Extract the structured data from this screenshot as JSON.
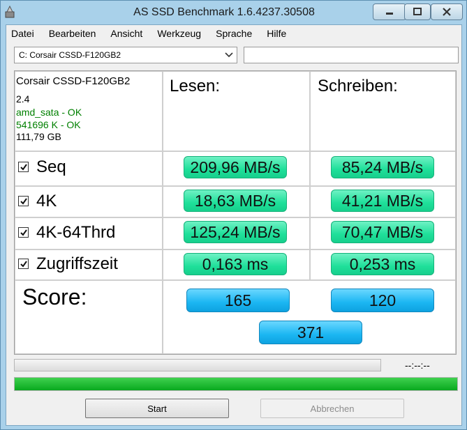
{
  "window": {
    "title": "AS SSD Benchmark 1.6.4237.30508"
  },
  "menu": {
    "items": [
      "Datei",
      "Bearbeiten",
      "Ansicht",
      "Werkzeug",
      "Sprache",
      "Hilfe"
    ]
  },
  "drive": {
    "selected": "C: Corsair CSSD-F120GB2",
    "text_value": ""
  },
  "info": {
    "model": "Corsair CSSD-F120GB2",
    "firmware": "2.4",
    "driver": "amd_sata - OK",
    "alignment": "541696 K - OK",
    "capacity": "111,79 GB",
    "ok_color": "#008000"
  },
  "columns": {
    "read": "Lesen:",
    "write": "Schreiben:"
  },
  "rows": [
    {
      "label": "Seq",
      "checked": true,
      "read": "209,96 MB/s",
      "write": "85,24 MB/s"
    },
    {
      "label": "4K",
      "checked": true,
      "read": "18,63 MB/s",
      "write": "41,21 MB/s"
    },
    {
      "label": "4K-64Thrd",
      "checked": true,
      "read": "125,24 MB/s",
      "write": "70,47 MB/s"
    },
    {
      "label": "Zugriffszeit",
      "checked": true,
      "read": "0,163 ms",
      "write": "0,253 ms"
    }
  ],
  "score": {
    "label": "Score:",
    "read": "165",
    "write": "120",
    "total": "371"
  },
  "progress": {
    "time": "--:--:--",
    "test_progress": 0,
    "overall_progress": 1.0
  },
  "buttons": {
    "start": "Start",
    "abort": "Abbrechen"
  },
  "colors": {
    "value_box": "#1fe09a",
    "score_box": "#1bb6f2",
    "progress": "#09a91f"
  }
}
